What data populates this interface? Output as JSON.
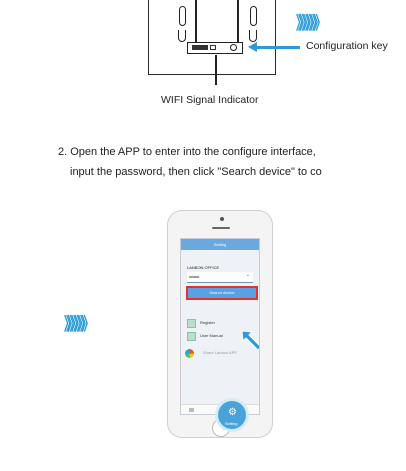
{
  "diagram": {
    "config_key_label": "Configuration key",
    "wifi_indicator_label": "WIFI Signal Indicator",
    "chevrons": "》》》》》》"
  },
  "step2": {
    "line1": "2. Open the APP to enter into the configure interface,",
    "line2": "input the password, then click  \"Search device\" to co"
  },
  "phone": {
    "title": "Setting",
    "ssid": "LANBON OFFICE",
    "password_mask": "•••••••••••",
    "search_button": "Search device",
    "menu": [
      {
        "label": "Register",
        "icon": "register-icon"
      },
      {
        "label": "User Manual",
        "icon": "manual-icon"
      }
    ],
    "share_label": "Share Lanbon APP",
    "settings_tab": "Setting",
    "settings_icon": "gear-icon"
  },
  "left_chevrons": "》》》》》》",
  "colors": {
    "accent": "#2a9bd8",
    "highlight": "#e0342c",
    "app_blue": "#5aa0e2"
  }
}
